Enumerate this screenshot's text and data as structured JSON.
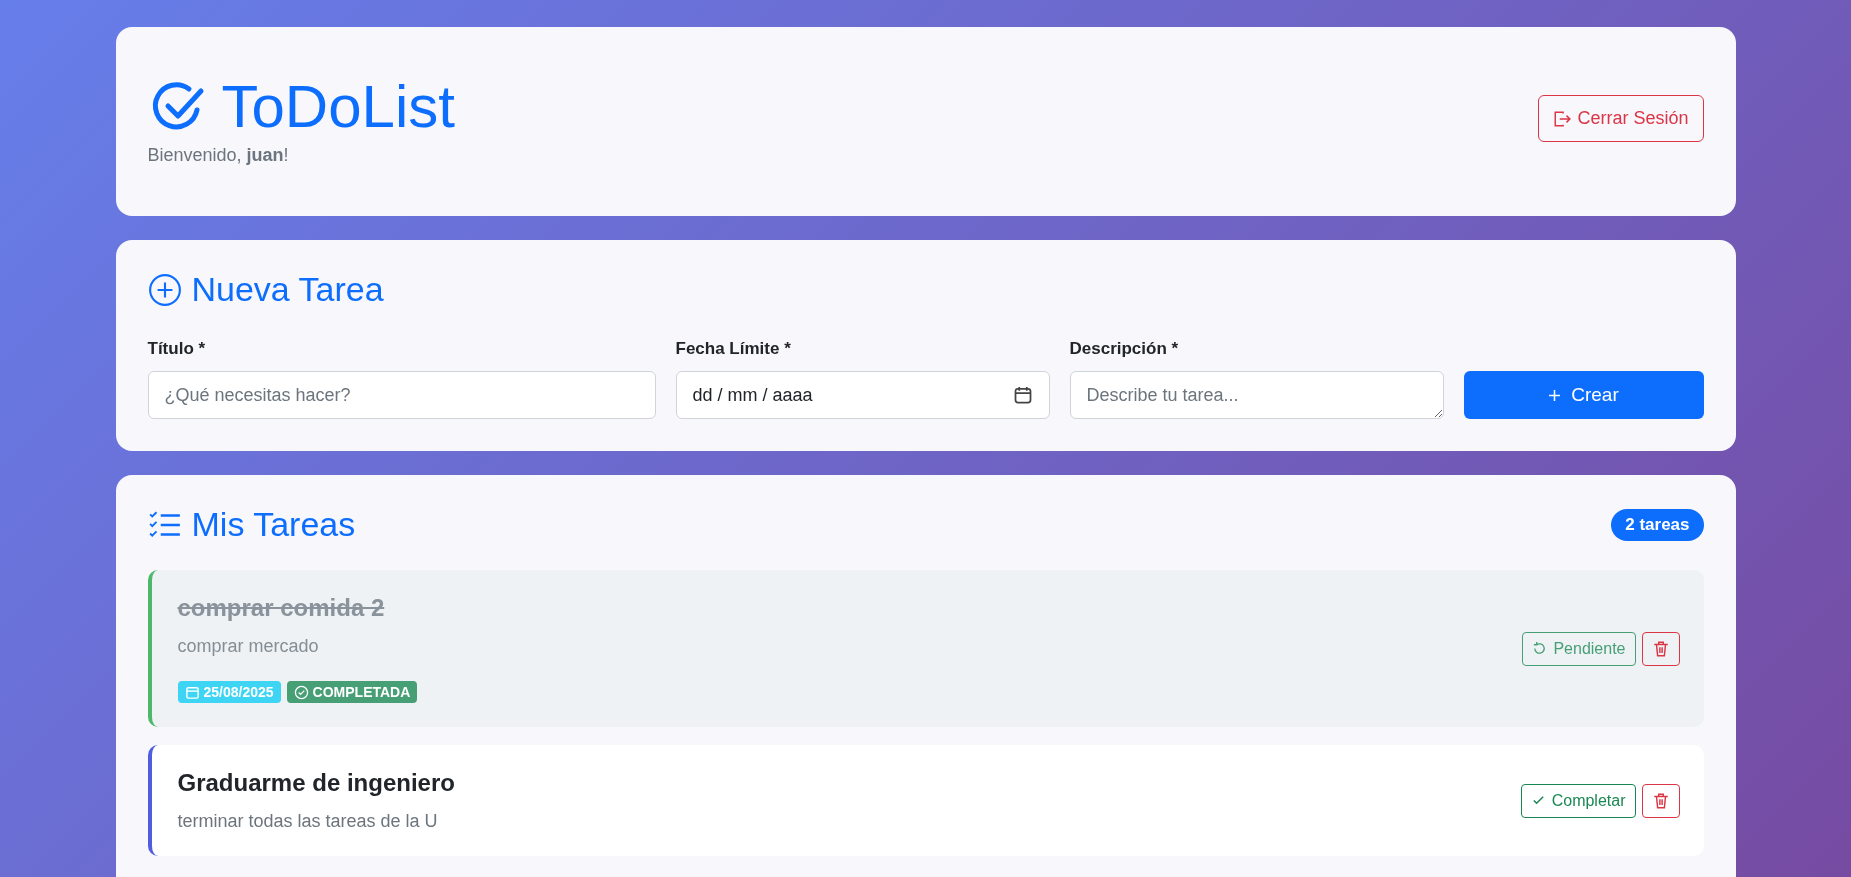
{
  "header": {
    "brand": "ToDoList",
    "welcome": "Bienvenido, **juan**!",
    "logout": "Cerrar Sesión"
  },
  "new_task": {
    "heading": "Nueva Tarea",
    "fields": [
      {
        "kind": "text",
        "label": "Título *",
        "placeholder": "¿Qué necesitas hacer?"
      },
      {
        "kind": "date",
        "label": "Fecha Límite *",
        "placeholder": "dd / mm / aaaa"
      },
      {
        "kind": "textarea",
        "label": "Descripción *",
        "placeholder": "Describe tu tarea..."
      }
    ],
    "submit": "Crear"
  },
  "tasks": {
    "heading": "Mis Tareas",
    "count": "2 tareas",
    "items": [
      {
        "title": "comprar comida 2",
        "description": "comprar mercado",
        "date": "25/08/2025",
        "status": "COMPLETADA",
        "completed": true,
        "action": "Pendiente"
      },
      {
        "title": "Graduarme de ingeniero",
        "description": "terminar todas las tareas de la U",
        "completed": false,
        "action": "Completar"
      }
    ]
  }
}
